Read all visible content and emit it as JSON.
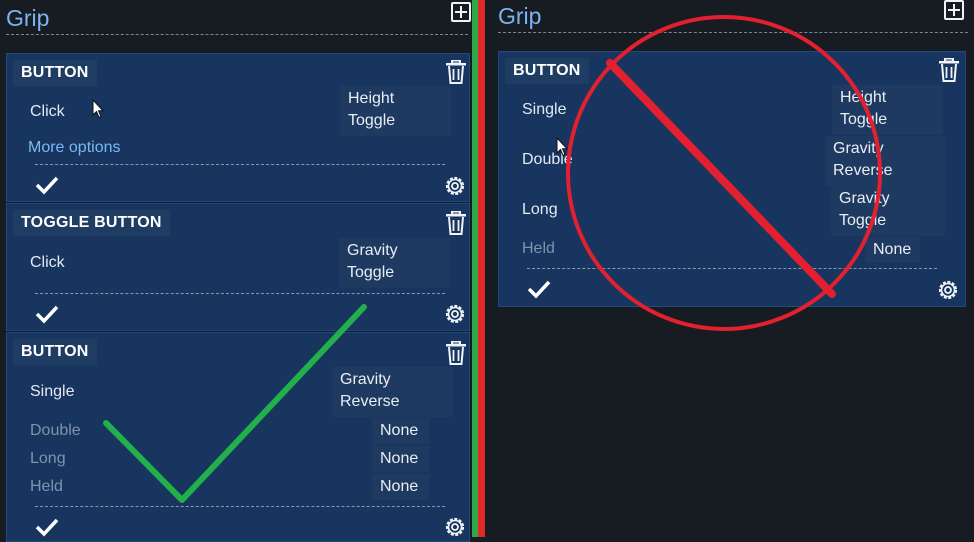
{
  "left_panel": {
    "title": "Grip",
    "cards": [
      {
        "title": "BUTTON",
        "rows": [
          {
            "label": "Click",
            "action": "Height\nToggle"
          }
        ],
        "more_options": "More options"
      },
      {
        "title": "TOGGLE BUTTON",
        "rows": [
          {
            "label": "Click",
            "action": "Gravity\nToggle"
          }
        ]
      },
      {
        "title": "BUTTON",
        "rows": [
          {
            "label": "Single",
            "action": "Gravity\nReverse"
          },
          {
            "label": "Double",
            "action": "None"
          },
          {
            "label": "Long",
            "action": "None"
          },
          {
            "label": "Held",
            "action": "None"
          }
        ]
      }
    ]
  },
  "right_panel": {
    "title": "Grip",
    "cards": [
      {
        "title": "BUTTON",
        "rows": [
          {
            "label": "Single",
            "action": "Height\nToggle"
          },
          {
            "label": "Double",
            "action": "Gravity\nReverse"
          },
          {
            "label": "Long",
            "action": "Gravity\nToggle"
          },
          {
            "label": "Held",
            "action": "None"
          }
        ]
      }
    ]
  },
  "annotations": {
    "approve_mark_color": "#22b04a",
    "reject_mark_color": "#e32030",
    "divider_colors": [
      "#2fa84a",
      "#e02a2a"
    ]
  },
  "icons": [
    "add-icon",
    "trash-icon",
    "check-icon",
    "gear-icon",
    "mouse-cursor-icon"
  ]
}
